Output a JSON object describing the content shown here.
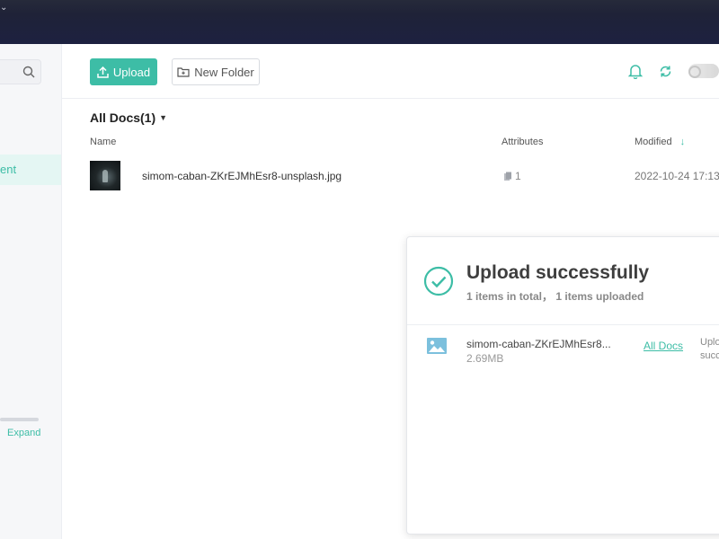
{
  "toolbar": {
    "upload_label": "Upload",
    "new_folder_label": "New Folder"
  },
  "sidebar": {
    "active_item_label": "ent",
    "expand_label": "Expand"
  },
  "breadcrumb": {
    "label": "All Docs(1)"
  },
  "table": {
    "columns": {
      "name": "Name",
      "attributes": "Attributes",
      "modified": "Modified"
    },
    "rows": [
      {
        "name": "simom-caban-ZKrEJMhEsr8-unsplash.jpg",
        "attribute_count": "1",
        "modified": "2022-10-24 17:13"
      }
    ]
  },
  "upload_panel": {
    "title": "Upload successfully",
    "summary": "1 items in total， 1 items uploaded",
    "items": [
      {
        "file_name": "simom-caban-ZKrEJMhEsr8...",
        "size": "2.69MB",
        "location": "All Docs",
        "status": "Uploaded successfully"
      }
    ]
  },
  "colors": {
    "accent": "#3dbda6",
    "titlebar": "#1d2140"
  },
  "icons": {
    "search": "search-icon",
    "upload": "upload-icon",
    "folder": "folder-plus-icon",
    "bell": "bell-icon",
    "sync": "sync-icon",
    "sort": "sort-down-arrow-icon",
    "attribute": "attribute-icon",
    "success": "check-circle-icon",
    "image": "image-icon"
  }
}
